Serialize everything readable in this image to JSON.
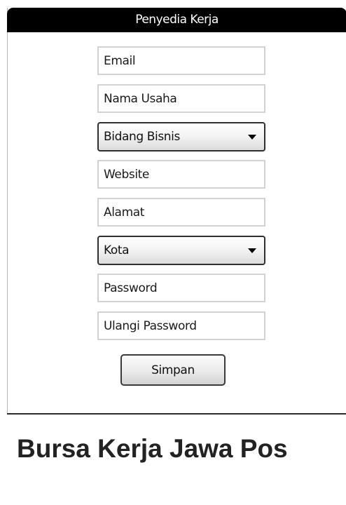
{
  "form": {
    "title": "Penyedia Kerja",
    "email_placeholder": "Email",
    "business_name_placeholder": "Nama Usaha",
    "business_field_selected": "Bidang Bisnis",
    "website_placeholder": "Website",
    "address_placeholder": "Alamat",
    "city_selected": "Kota",
    "password_placeholder": "Password",
    "confirm_password_placeholder": "Ulangi Password",
    "save_label": "Simpan"
  },
  "footer": {
    "brand": "Bursa Kerja Jawa Pos"
  }
}
